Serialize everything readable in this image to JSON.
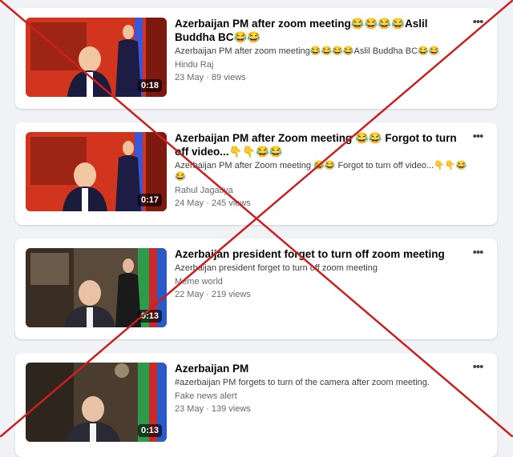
{
  "results": [
    {
      "title": "Azerbaijan PM after zoom meeting😂😂😂😂Aslil Buddha BC😂😂",
      "description": "Azerbaijan PM after zoom meeting😂😂😂😂Aslil Buddha BC😂😂",
      "author": "Hindu Raj",
      "meta": "23 May · 89 views",
      "duration": "0:18",
      "thumb_style": "red"
    },
    {
      "title": "Azerbaijan PM after Zoom meeting 😂😂 Forgot to turn off video...👇👇😂😂",
      "description": "Azerbaijan PM after Zoom meeting 😂😂 Forgot to turn off video...👇👇😂😂",
      "author": "Rahul Jagatiya",
      "meta": "24 May · 245 views",
      "duration": "0:17",
      "thumb_style": "red"
    },
    {
      "title": "Azerbaijan president forget to turn off zoom meeting",
      "description": "Azerbaijan president forget to turn off zoom meeting",
      "author": "Meme world",
      "meta": "22 May · 219 views",
      "duration": "0:13",
      "thumb_style": "natural"
    },
    {
      "title": "Azerbaijan PM",
      "description": "#azerbaijan PM forgets to turn of the camera after zoom meeting.",
      "author": "Fake news alert",
      "meta": "23 May · 139 views",
      "duration": "0:13",
      "thumb_style": "natural"
    }
  ],
  "more_icon": "more-horizontal-icon",
  "overlay": {
    "mark": "red-x",
    "color": "#cc1f1f"
  }
}
